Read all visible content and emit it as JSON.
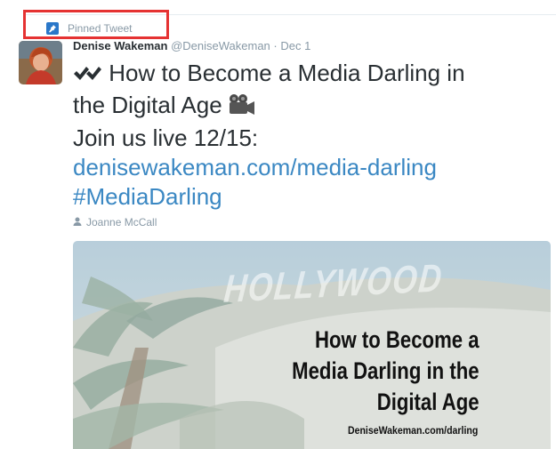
{
  "pinned": {
    "label": "Pinned Tweet"
  },
  "tweet": {
    "author_name": "Denise Wakeman",
    "handle": "@DeniseWakeman",
    "separator": "·",
    "date": "Dec 1",
    "text_line1": "How to Become a Media Darling in",
    "text_line2": "the Digital Age",
    "text_line3": "Join us live 12/15:",
    "link": "denisewakeman.com/media-darling",
    "hashtag": "#MediaDarling",
    "tagged_user": "Joanne McCall"
  },
  "media": {
    "background_sign": "HOLLYWOOD",
    "title_line1": "How to Become a",
    "title_line2": "Media Darling in the",
    "title_line3": "Digital Age",
    "url": "DeniseWakeman.com/darling"
  },
  "icons": {
    "pin": "pin-icon",
    "check": "heavy-check-mark-icon",
    "camera": "movie-camera-icon",
    "person": "person-icon"
  },
  "colors": {
    "link": "#3b88c3",
    "meta": "#8899a6",
    "text": "#292f33",
    "highlight": "#e53232",
    "pin_badge": "#2a77c9"
  }
}
